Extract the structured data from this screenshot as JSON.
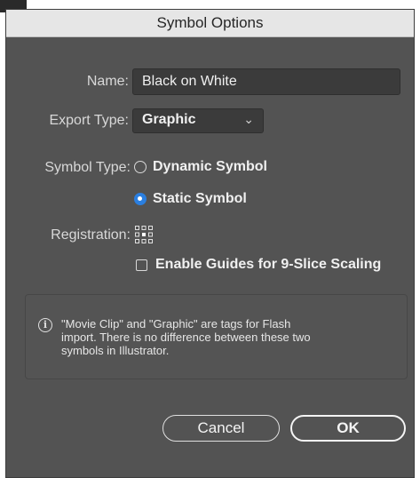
{
  "dialog": {
    "title": "Symbol Options"
  },
  "fields": {
    "name_label": "Name:",
    "name_value": "Black on White",
    "export_type_label": "Export Type:",
    "export_type_value": "Graphic",
    "symbol_type_label": "Symbol Type:",
    "symbol_type_options": [
      {
        "label": "Dynamic Symbol",
        "selected": false
      },
      {
        "label": "Static Symbol",
        "selected": true
      }
    ],
    "registration_label": "Registration:",
    "guides_label": "Enable Guides for 9-Slice Scaling",
    "guides_checked": false
  },
  "info": {
    "text": "\"Movie Clip\" and \"Graphic\" are tags for Flash import. There is no difference between these two symbols in Illustrator."
  },
  "buttons": {
    "cancel": "Cancel",
    "ok": "OK"
  },
  "colors": {
    "dialog_bg": "#535353",
    "accent": "#2b7fe0"
  },
  "icons": {
    "info": "info-icon",
    "chevron": "chevron-down-icon",
    "registration": "registration-grid-icon"
  }
}
